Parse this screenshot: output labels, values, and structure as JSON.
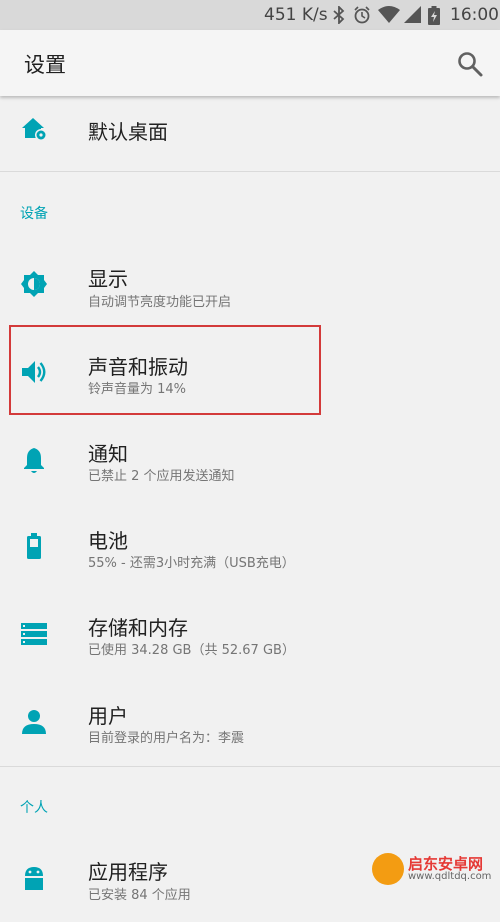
{
  "status_bar": {
    "network_speed": "451 K/s",
    "time": "16:00",
    "icons": [
      "bluetooth-icon",
      "alarm-icon",
      "wifi-icon",
      "signal-icon",
      "battery-icon"
    ]
  },
  "toolbar": {
    "title": "设置",
    "search_icon": "search-icon"
  },
  "items_top": [
    {
      "label": "默认桌面",
      "icon": "home-gear-icon"
    }
  ],
  "section_device": "设备",
  "device_items": [
    {
      "label": "显示",
      "sub": "自动调节亮度功能已开启",
      "icon": "brightness-icon"
    },
    {
      "label": "声音和振动",
      "sub": "铃声音量为 14%",
      "icon": "volume-icon"
    },
    {
      "label": "通知",
      "sub": "已禁止 2 个应用发送通知",
      "icon": "bell-icon"
    },
    {
      "label": "电池",
      "sub": "55% - 还需3小时充满（USB充电）",
      "icon": "battery-charging-icon"
    },
    {
      "label": "存储和内存",
      "sub": "已使用 34.28 GB（共 52.67 GB）",
      "icon": "storage-icon"
    },
    {
      "label": "用户",
      "sub": "目前登录的用户名为：李震",
      "icon": "person-icon"
    }
  ],
  "section_personal": "个人",
  "personal_items": [
    {
      "label": "应用程序",
      "sub": "已安装 84 个应用",
      "icon": "android-icon"
    }
  ],
  "watermark": {
    "name": "启东安卓网",
    "url": "www.qdltdq.com"
  },
  "colors": {
    "accent": "#00a3b4",
    "highlight_box": "#d33a3a",
    "background": "#f1f1f1",
    "status_bar": "#d9d9d9"
  }
}
